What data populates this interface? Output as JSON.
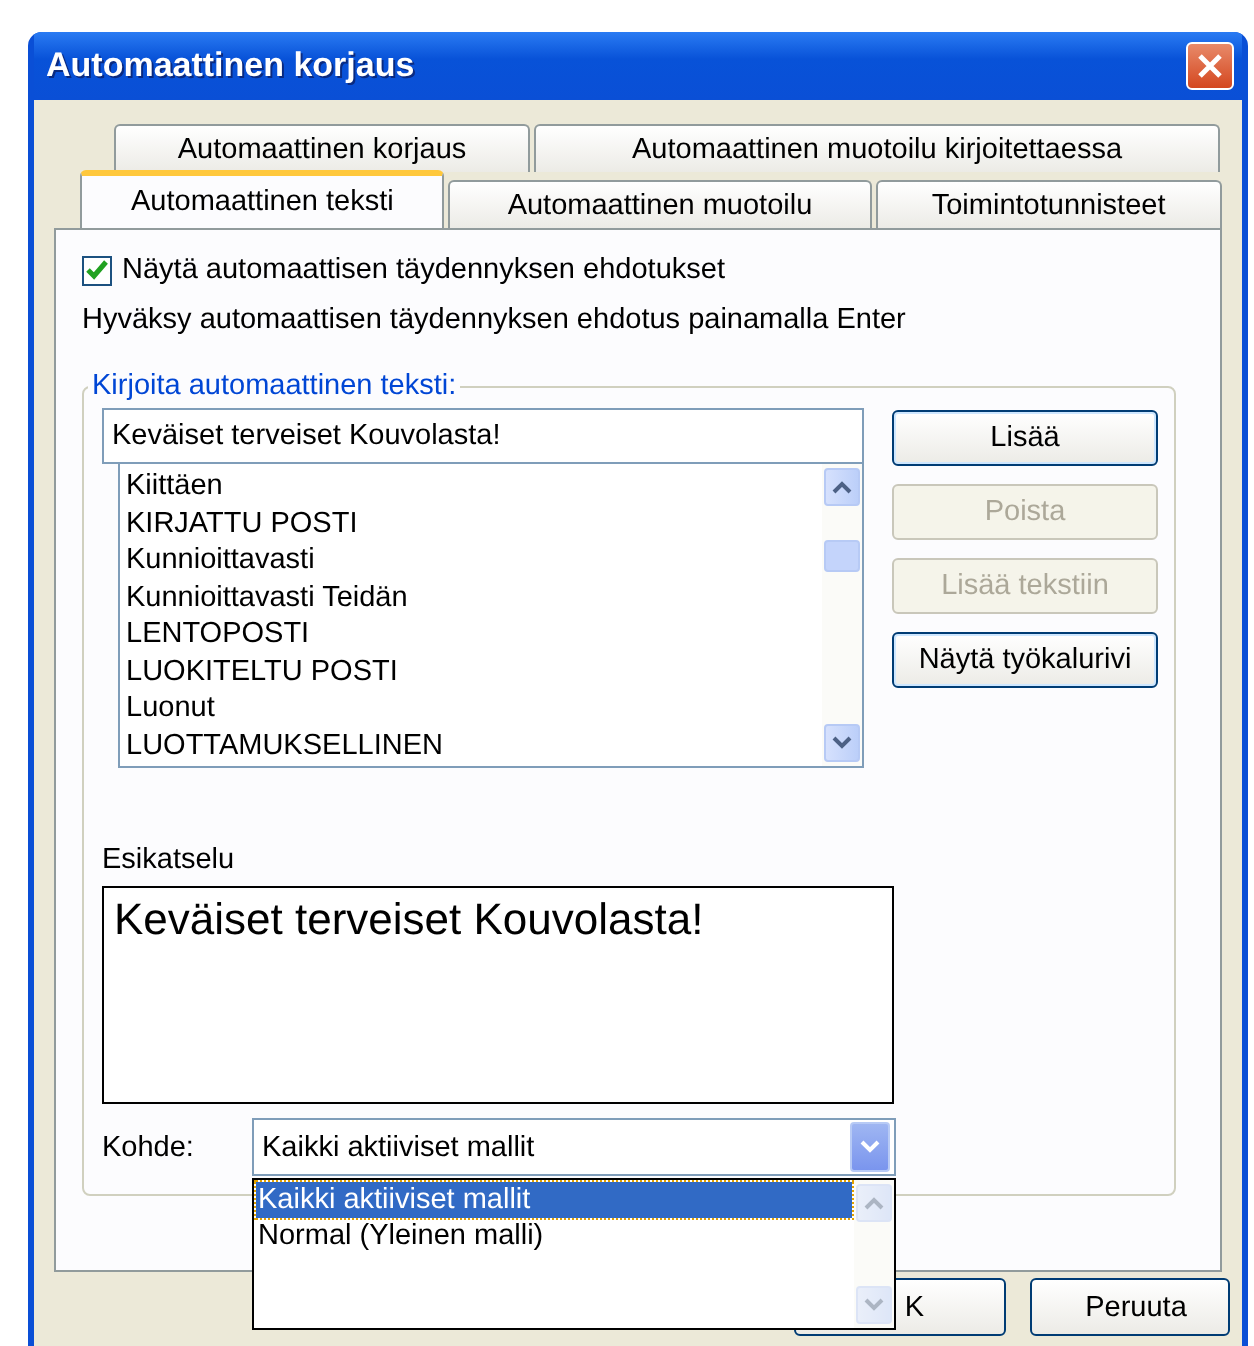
{
  "window": {
    "title": "Automaattinen korjaus"
  },
  "tab_rows": [
    [
      {
        "label": "Automaattinen korjaus",
        "selected": false
      },
      {
        "label": "Automaattinen muotoilu kirjoitettaessa",
        "selected": false
      }
    ],
    [
      {
        "label": "Automaattinen teksti",
        "selected": true
      },
      {
        "label": "Automaattinen muotoilu",
        "selected": false
      },
      {
        "label": "Toimintotunnisteet",
        "selected": false
      }
    ]
  ],
  "show_suggestions": {
    "label": "Näytä automaattisen täydennyksen ehdotukset",
    "checked": true
  },
  "hint": "Hyväksy automaattisen täydennyksen ehdotus painamalla Enter",
  "entry_group": {
    "label": "Kirjoita automaattinen teksti:",
    "value": "Keväiset terveiset Kouvolasta!",
    "entries": [
      "Kiittäen",
      "KIRJATTU POSTI",
      "Kunnioittavasti",
      "Kunnioittavasti Teidän",
      "LENTOPOSTI",
      "LUOKITELTU POSTI",
      "Luonut",
      "LUOTTAMUKSELLINEN"
    ]
  },
  "buttons": [
    {
      "label": "Lisää",
      "disabled": false
    },
    {
      "label": "Poista",
      "disabled": true
    },
    {
      "label": "Lisää tekstiin",
      "disabled": true
    },
    {
      "label": "Näytä työkalurivi",
      "disabled": false
    }
  ],
  "preview": {
    "label": "Esikatselu",
    "text": "Keväiset terveiset Kouvolasta!"
  },
  "target": {
    "label": "Kohde:",
    "value": "Kaikki aktiiviset mallit",
    "expanded": true,
    "options": [
      {
        "label": "Kaikki aktiiviset mallit",
        "selected": true
      },
      {
        "label": "Normal (Yleinen malli)",
        "selected": false
      }
    ]
  },
  "footer_buttons": [
    "K",
    "Peruuta"
  ]
}
